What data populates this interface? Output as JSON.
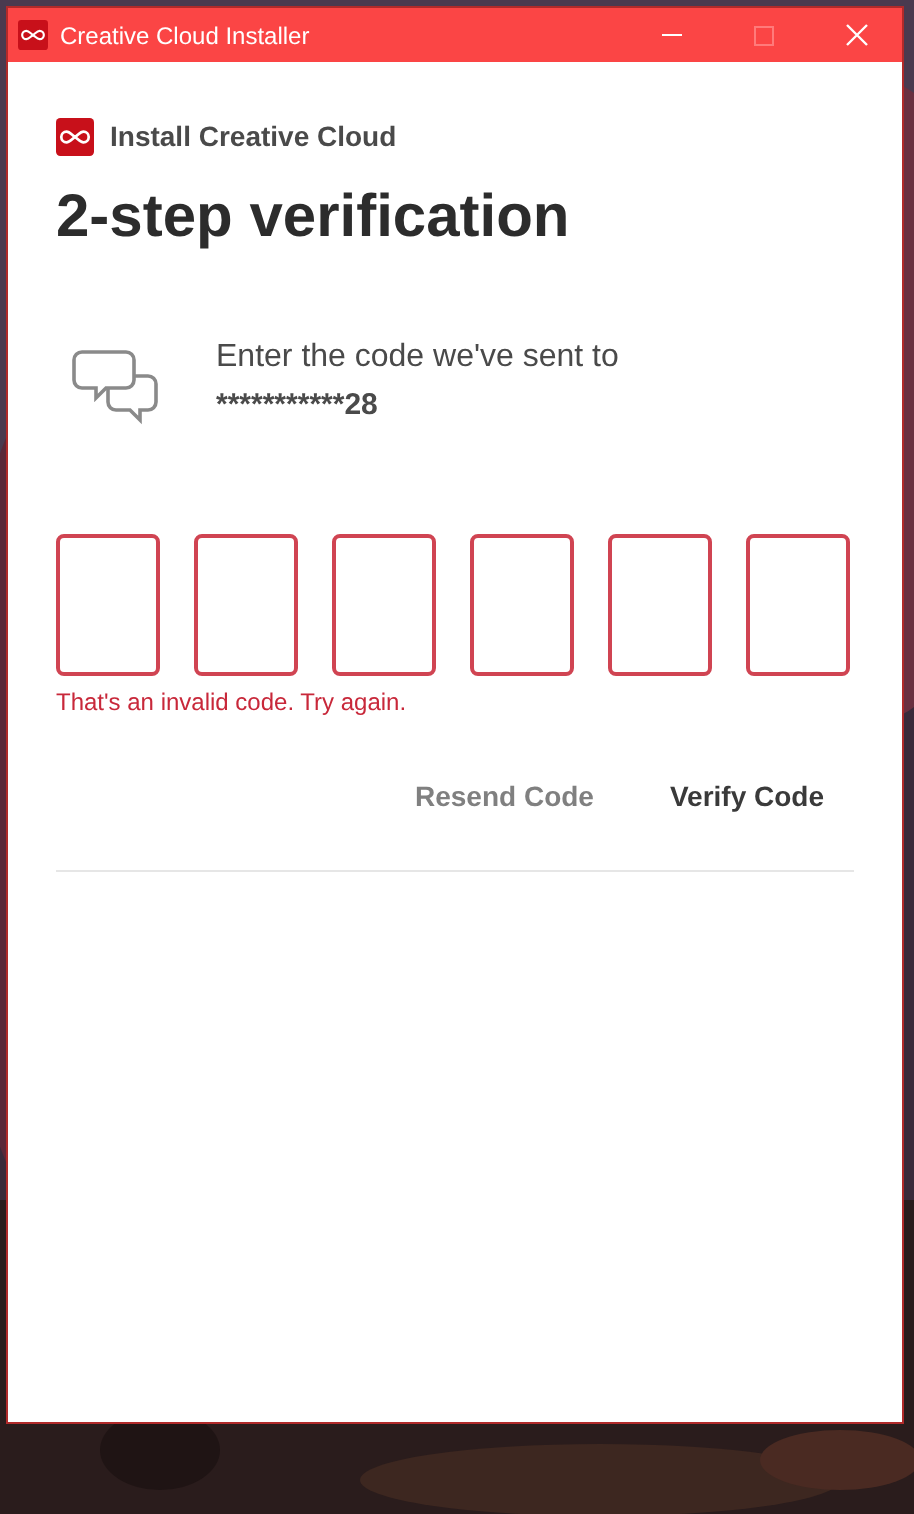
{
  "window": {
    "title": "Creative Cloud Installer",
    "maximize_disabled": true
  },
  "header": {
    "app_name": "Install Creative Cloud"
  },
  "title": "2-step verification",
  "message": {
    "line": "Enter the code we've sent to",
    "masked_phone": "***********28"
  },
  "code_boxes": [
    {
      "invalid": true
    },
    {
      "invalid": true
    },
    {
      "invalid": true
    },
    {
      "invalid": true
    },
    {
      "invalid": true
    },
    {
      "invalid": true
    }
  ],
  "error": "That's an invalid code. Try again.",
  "buttons": [
    {
      "label": "Resend Code",
      "disabled": true
    },
    {
      "label": "Verify Code",
      "disabled": false
    }
  ]
}
